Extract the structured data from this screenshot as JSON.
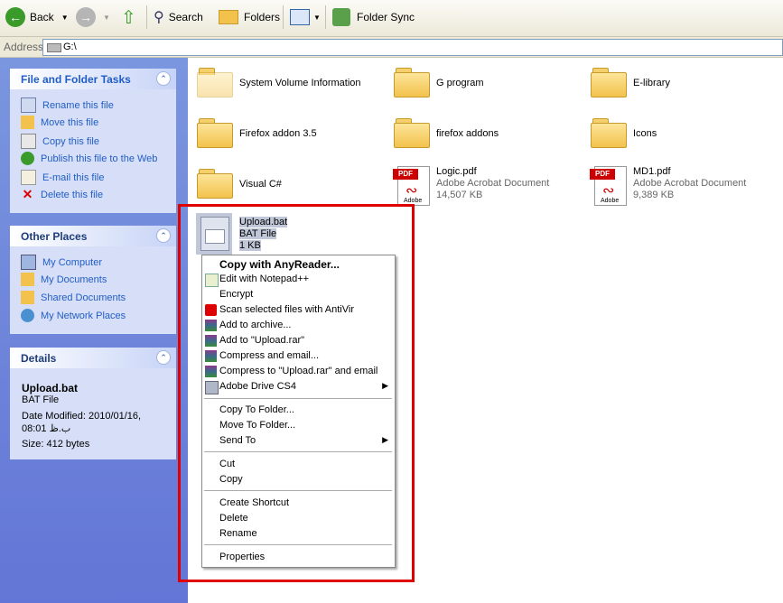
{
  "toolbar": {
    "back": "Back",
    "search": "Search",
    "folders": "Folders",
    "folder_sync": "Folder Sync"
  },
  "address": {
    "label": "Address",
    "value": "G:\\"
  },
  "file_tasks": {
    "title": "File and Folder Tasks",
    "items": [
      "Rename this file",
      "Move this file",
      "Copy this file",
      "Publish this file to the Web",
      "E-mail this file",
      "Delete this file"
    ]
  },
  "other_places": {
    "title": "Other Places",
    "items": [
      "My Computer",
      "My Documents",
      "Shared Documents",
      "My Network Places"
    ]
  },
  "details": {
    "title": "Details",
    "name": "Upload.bat",
    "type": "BAT File",
    "modified_line1": "Date Modified: 2010/01/16,",
    "modified_line2": "08:01 ب.ظ",
    "size": "Size: 412 bytes"
  },
  "files": [
    {
      "name": "System Volume Information"
    },
    {
      "name": "G program"
    },
    {
      "name": "E-library"
    },
    {
      "name": "Firefox addon 3.5"
    },
    {
      "name": "firefox addons"
    },
    {
      "name": "Icons"
    },
    {
      "name": "Visual C#"
    },
    {
      "name": "Logic.pdf",
      "type": "Adobe Acrobat Document",
      "size": "14,507 KB"
    },
    {
      "name": "MD1.pdf",
      "type": "Adobe Acrobat Document",
      "size": "9,389 KB"
    },
    {
      "name": "Upload.bat",
      "type": "BAT File",
      "size": "1 KB"
    }
  ],
  "pdf_tag": "PDF",
  "pdf_brand": "Adobe",
  "context_menu": [
    "Copy with AnyReader...",
    "Edit with Notepad++",
    "Encrypt",
    "Scan selected files with AntiVir",
    "Add to archive...",
    "Add to \"Upload.rar\"",
    "Compress and email...",
    "Compress to \"Upload.rar\" and email",
    "Adobe Drive CS4",
    "Copy To Folder...",
    "Move To Folder...",
    "Send To",
    "Cut",
    "Copy",
    "Create Shortcut",
    "Delete",
    "Rename",
    "Properties"
  ],
  "colors": {
    "highlight": "#e00000",
    "link": "#215dc6"
  }
}
